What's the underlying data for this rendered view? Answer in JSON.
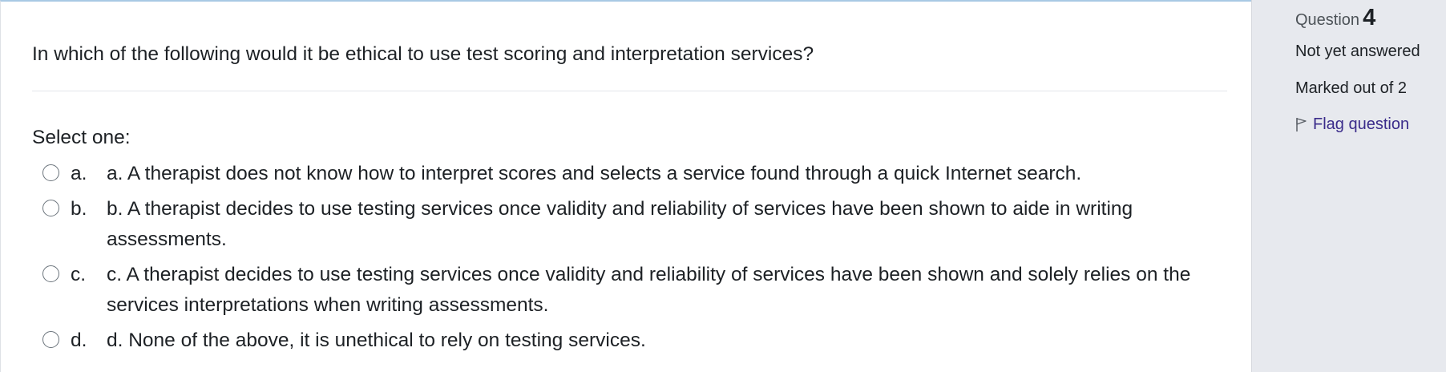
{
  "question": {
    "text": "In which of the following would it be ethical to use test scoring and interpretation services?",
    "prompt": "Select one:",
    "answers": [
      {
        "letter": "a.",
        "text": "a. A therapist does not know how to interpret scores and selects a service found through a quick Internet search."
      },
      {
        "letter": "b.",
        "text": "b. A therapist decides to use testing services once validity and reliability of services have been shown to aide in writing assessments."
      },
      {
        "letter": "c.",
        "text": "c. A therapist decides to use testing services once validity and reliability of services have been shown and solely relies on the services interpretations when writing assessments."
      },
      {
        "letter": "d.",
        "text": "d. None of the above, it is unethical to rely on testing services."
      }
    ]
  },
  "info": {
    "question_label": "Question",
    "question_number": "4",
    "state": "Not yet answered",
    "grade": "Marked out of 2",
    "flag_label": "Flag question",
    "flag_icon": "flag-outline-icon"
  },
  "colors": {
    "link": "#3a2b8a",
    "info_background": "#e7e9ee",
    "top_border": "#a9c9e4"
  }
}
